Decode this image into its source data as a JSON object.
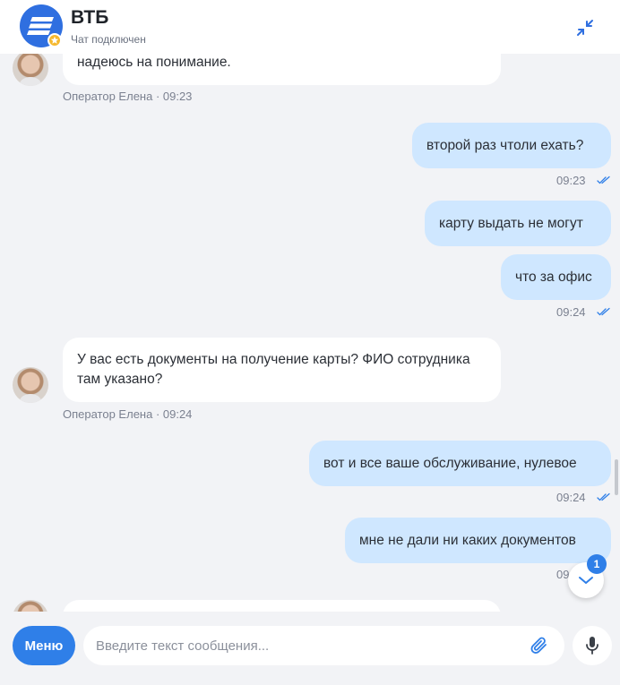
{
  "header": {
    "bank_name": "ВТБ",
    "status": "Чат подключен"
  },
  "messages": [
    {
      "direction": "in",
      "text": "надеюсь на понимание.",
      "meta": "Оператор Елена · 09:23"
    },
    {
      "direction": "out",
      "text": "второй раз чтоли ехать?",
      "time": "09:23",
      "read": true
    },
    {
      "direction": "out",
      "text": "карту выдать не могут"
    },
    {
      "direction": "out",
      "text": "что за офис",
      "time": "09:24",
      "read": true
    },
    {
      "direction": "in",
      "text": "У вас есть документы на получение карты? ФИО сотрудника там указано?",
      "meta": "Оператор Елена · 09:24"
    },
    {
      "direction": "out",
      "text": "вот и все ваше обслуживание, нулевое",
      "time": "09:24",
      "read": true
    },
    {
      "direction": "out",
      "text": "мне не дали ни каких документов",
      "time": "09:",
      "read": true
    }
  ],
  "scroll_down": {
    "unread_count": "1"
  },
  "composer": {
    "menu_label": "Меню",
    "placeholder": "Введите текст сообщения..."
  },
  "colors": {
    "accent": "#2f7fe8",
    "outgoing_bubble": "#cfe7ff",
    "incoming_bubble": "#ffffff",
    "background": "#f2f3f6"
  }
}
